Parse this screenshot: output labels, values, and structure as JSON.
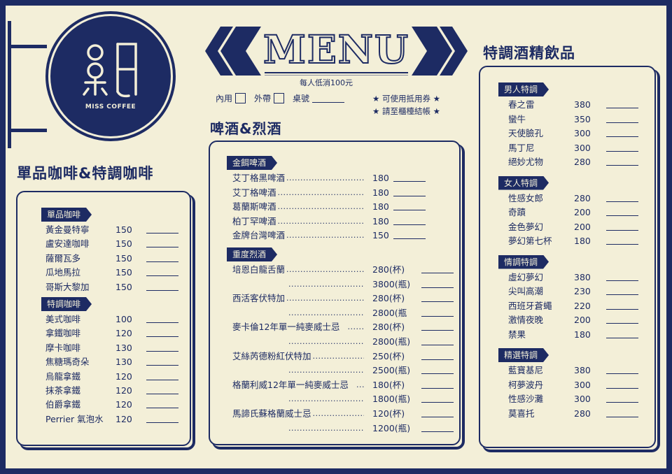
{
  "logo": {
    "name": "MISS COFFEE"
  },
  "banner": {
    "title": "MENU",
    "min_charge": "每人低消100元",
    "dine_in": "內用",
    "takeout": "外帶",
    "table_no": "桌號",
    "note1": "★ 可使用抵用券 ★",
    "note2": "★ 請至櫃檯結帳 ★"
  },
  "coffee": {
    "heading": "單品咖啡&特調咖啡",
    "sections": [
      {
        "label": "單品咖啡",
        "items": [
          {
            "name": "黃金曼特寧",
            "price": "150"
          },
          {
            "name": "盧安達咖啡",
            "price": "150"
          },
          {
            "name": "薩爾瓦多",
            "price": "150"
          },
          {
            "name": "瓜地馬拉",
            "price": "150"
          },
          {
            "name": "哥斯大黎加",
            "price": "150"
          }
        ]
      },
      {
        "label": "特調咖啡",
        "items": [
          {
            "name": "美式咖啡",
            "price": "100"
          },
          {
            "name": "拿鐵咖啡",
            "price": "120"
          },
          {
            "name": "摩卡咖啡",
            "price": "130"
          },
          {
            "name": "焦糖瑪奇朵",
            "price": "130"
          },
          {
            "name": "烏龍拿鐵",
            "price": "120"
          },
          {
            "name": "抹茶拿鐵",
            "price": "120"
          },
          {
            "name": "伯爵拿鐵",
            "price": "120"
          },
          {
            "name": "Perrier 氣泡水",
            "price": "120"
          }
        ]
      }
    ]
  },
  "beer": {
    "heading": "啤酒&烈酒",
    "sections": [
      {
        "label": "金餌啤酒",
        "items": [
          {
            "name": "艾丁格黑啤酒",
            "price": "180"
          },
          {
            "name": "艾丁格啤酒",
            "price": "180"
          },
          {
            "name": "葛蘭斯啤酒",
            "price": "180"
          },
          {
            "name": "柏丁罕啤酒",
            "price": "180"
          },
          {
            "name": "金牌台灣啤酒",
            "price": "150"
          }
        ]
      },
      {
        "label": "重度烈酒",
        "items": [
          {
            "name": "培恩白龍舌蘭",
            "price": "280(杯)"
          },
          {
            "name": "",
            "price": "3800(瓶)"
          },
          {
            "name": "西活客伏特加",
            "price": "280(杯)"
          },
          {
            "name": "",
            "price": "2800(瓶"
          },
          {
            "name": "麥卡倫12年單一純麥威士忌",
            "price": "280(杯)"
          },
          {
            "name": "",
            "price": "2800(瓶)"
          },
          {
            "name": "艾絲芮德粉紅伏特加",
            "price": "250(杯)"
          },
          {
            "name": "",
            "price": "2500(瓶)"
          },
          {
            "name": "格蘭利威12年單一純麥威士忌",
            "price": "180(杯)"
          },
          {
            "name": "",
            "price": "1800(瓶)"
          },
          {
            "name": "馬諦氏蘇格蘭威士忌",
            "price": "120(杯)"
          },
          {
            "name": "",
            "price": "1200(瓶)"
          }
        ]
      }
    ]
  },
  "cocktail": {
    "heading": "特調酒精飲品",
    "sections": [
      {
        "label": "男人特調",
        "items": [
          {
            "name": "春之雷",
            "price": "380"
          },
          {
            "name": "蠻牛",
            "price": "350"
          },
          {
            "name": "天使臉孔",
            "price": "300"
          },
          {
            "name": "馬丁尼",
            "price": "300"
          },
          {
            "name": "絕妙尤物",
            "price": "280"
          }
        ]
      },
      {
        "label": "女人特調",
        "items": [
          {
            "name": "性感女郎",
            "price": "280"
          },
          {
            "name": "奇蹟",
            "price": "200"
          },
          {
            "name": "金色夢幻",
            "price": "200"
          },
          {
            "name": "夢幻第七杯",
            "price": "180"
          }
        ]
      },
      {
        "label": "情調特調",
        "items": [
          {
            "name": "虛幻夢幻",
            "price": "380"
          },
          {
            "name": "尖叫高潮",
            "price": "230"
          },
          {
            "name": "西班牙蒼蠅",
            "price": "220"
          },
          {
            "name": "激情夜晚",
            "price": "200"
          },
          {
            "name": "禁果",
            "price": "180"
          }
        ]
      },
      {
        "label": "精選特調",
        "items": [
          {
            "name": "藍寶基尼",
            "price": "380"
          },
          {
            "name": "柯夢波丹",
            "price": "300"
          },
          {
            "name": "性感沙灘",
            "price": "300"
          },
          {
            "name": "莫喜托",
            "price": "280"
          }
        ]
      }
    ]
  }
}
